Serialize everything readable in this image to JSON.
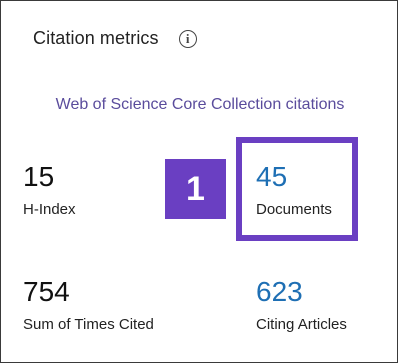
{
  "panel": {
    "title": "Citation metrics",
    "info_icon": "info-circle-icon",
    "collection_label": "Web of Science Core Collection citations"
  },
  "metrics": {
    "h_index": {
      "value": "15",
      "label": "H-Index"
    },
    "documents": {
      "value": "45",
      "label": "Documents"
    },
    "sum_times_cited": {
      "value": "754",
      "label": "Sum of Times Cited"
    },
    "citing_articles": {
      "value": "623",
      "label": "Citing Articles"
    }
  },
  "annotation": {
    "step_number": "1",
    "color": "#6a3fc2"
  },
  "colors": {
    "link": "#1e6fb4",
    "collection_text": "#5a4c9c"
  }
}
